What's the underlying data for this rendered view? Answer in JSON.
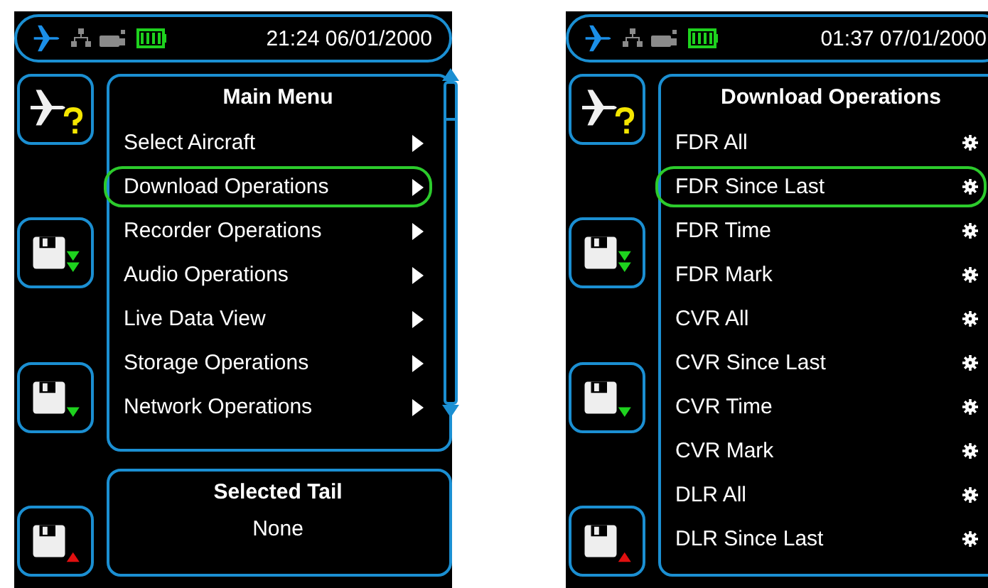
{
  "screens": [
    {
      "status_bar": {
        "time": "21:24 06/01/2000"
      },
      "side_buttons": [
        {
          "kind": "aircraft-query"
        },
        {
          "kind": "download-double"
        },
        {
          "kind": "download"
        },
        {
          "kind": "upload"
        }
      ],
      "menu": {
        "title": "Main Menu",
        "scrollbar": true,
        "items": [
          {
            "label": "Select Aircraft",
            "kind": "submenu",
            "selected": false
          },
          {
            "label": "Download Operations",
            "kind": "submenu",
            "selected": true
          },
          {
            "label": "Recorder Operations",
            "kind": "submenu",
            "selected": false
          },
          {
            "label": "Audio Operations",
            "kind": "submenu",
            "selected": false
          },
          {
            "label": "Live Data View",
            "kind": "submenu",
            "selected": false
          },
          {
            "label": "Storage Operations",
            "kind": "submenu",
            "selected": false
          },
          {
            "label": "Network Operations",
            "kind": "submenu",
            "selected": false
          }
        ]
      },
      "info_panel": {
        "title": "Selected Tail",
        "value": "None"
      }
    },
    {
      "status_bar": {
        "time": "01:37 07/01/2000"
      },
      "side_buttons": [
        {
          "kind": "aircraft-query"
        },
        {
          "kind": "download-double"
        },
        {
          "kind": "download"
        },
        {
          "kind": "upload"
        }
      ],
      "menu": {
        "title": "Download Operations",
        "scrollbar": false,
        "items": [
          {
            "label": "FDR All",
            "kind": "action",
            "selected": false
          },
          {
            "label": "FDR Since Last",
            "kind": "action",
            "selected": true
          },
          {
            "label": "FDR Time",
            "kind": "action",
            "selected": false
          },
          {
            "label": "FDR Mark",
            "kind": "action",
            "selected": false
          },
          {
            "label": "CVR All",
            "kind": "action",
            "selected": false
          },
          {
            "label": "CVR Since Last",
            "kind": "action",
            "selected": false
          },
          {
            "label": "CVR Time",
            "kind": "action",
            "selected": false
          },
          {
            "label": "CVR Mark",
            "kind": "action",
            "selected": false
          },
          {
            "label": "DLR All",
            "kind": "action",
            "selected": false
          },
          {
            "label": "DLR Since Last",
            "kind": "action",
            "selected": false
          }
        ]
      }
    }
  ]
}
